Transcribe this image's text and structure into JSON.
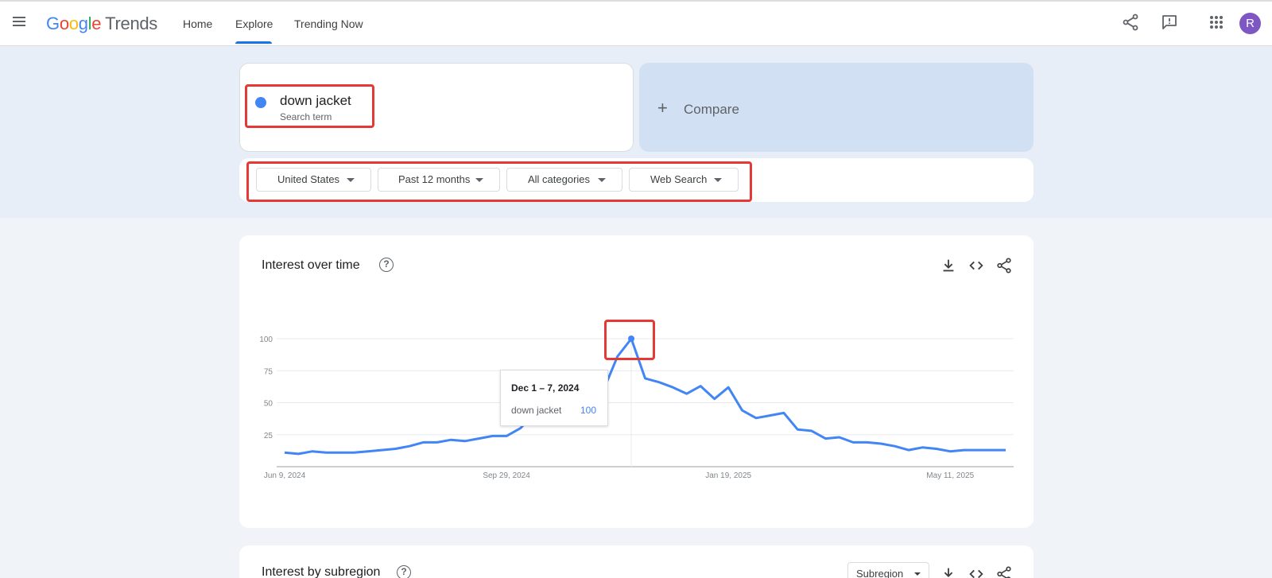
{
  "header": {
    "logo_google": [
      "G",
      "o",
      "o",
      "g",
      "l",
      "e"
    ],
    "logo_product": "Trends",
    "nav_tabs": [
      "Home",
      "Explore",
      "Trending Now"
    ],
    "active_tab": "Explore",
    "avatar_initial": "R"
  },
  "search": {
    "term": "down jacket",
    "term_type": "Search term",
    "term_color": "#4285f4",
    "compare_label": "Compare"
  },
  "filters": {
    "region": "United States",
    "time_range": "Past 12 months",
    "category": "All categories",
    "search_type": "Web Search"
  },
  "interest_over_time": {
    "title": "Interest over time",
    "tooltip": {
      "date": "Dec 1 – 7, 2024",
      "term": "down jacket",
      "value": "100"
    }
  },
  "interest_by_subregion": {
    "title": "Interest by subregion",
    "select_label": "Subregion"
  },
  "chart_data": {
    "type": "line",
    "title": "Interest over time",
    "xlabel": "",
    "ylabel": "",
    "ylim": [
      0,
      100
    ],
    "y_ticks": [
      "25",
      "50",
      "75",
      "100"
    ],
    "x_tick_labels": [
      "Jun 9, 2024",
      "Sep 29, 2024",
      "Jan 19, 2025",
      "May 11, 2025"
    ],
    "grid": true,
    "series": [
      {
        "name": "down jacket",
        "color": "#4285f4",
        "x": [
          "2024-06-09",
          "2024-06-16",
          "2024-06-23",
          "2024-06-30",
          "2024-07-07",
          "2024-07-14",
          "2024-07-21",
          "2024-07-28",
          "2024-08-04",
          "2024-08-11",
          "2024-08-18",
          "2024-08-25",
          "2024-09-01",
          "2024-09-08",
          "2024-09-15",
          "2024-09-22",
          "2024-09-29",
          "2024-10-06",
          "2024-10-13",
          "2024-10-20",
          "2024-10-27",
          "2024-11-03",
          "2024-11-10",
          "2024-11-17",
          "2024-11-24",
          "2024-12-01",
          "2024-12-08",
          "2024-12-15",
          "2024-12-22",
          "2024-12-29",
          "2025-01-05",
          "2025-01-12",
          "2025-01-19",
          "2025-01-26",
          "2025-02-02",
          "2025-02-09",
          "2025-02-16",
          "2025-02-23",
          "2025-03-02",
          "2025-03-09",
          "2025-03-16",
          "2025-03-23",
          "2025-03-30",
          "2025-04-06",
          "2025-04-13",
          "2025-04-20",
          "2025-04-27",
          "2025-05-04",
          "2025-05-11",
          "2025-05-18",
          "2025-05-25",
          "2025-06-01",
          "2025-06-08"
        ],
        "values": [
          11,
          10,
          12,
          11,
          11,
          11,
          12,
          13,
          14,
          16,
          19,
          19,
          21,
          20,
          22,
          24,
          24,
          30,
          41,
          36,
          39,
          37,
          51,
          60,
          86,
          100,
          69,
          66,
          62,
          57,
          63,
          53,
          62,
          44,
          38,
          40,
          42,
          29,
          28,
          22,
          23,
          19,
          19,
          18,
          16,
          13,
          15,
          14,
          12,
          13,
          13,
          13,
          13
        ]
      }
    ]
  }
}
